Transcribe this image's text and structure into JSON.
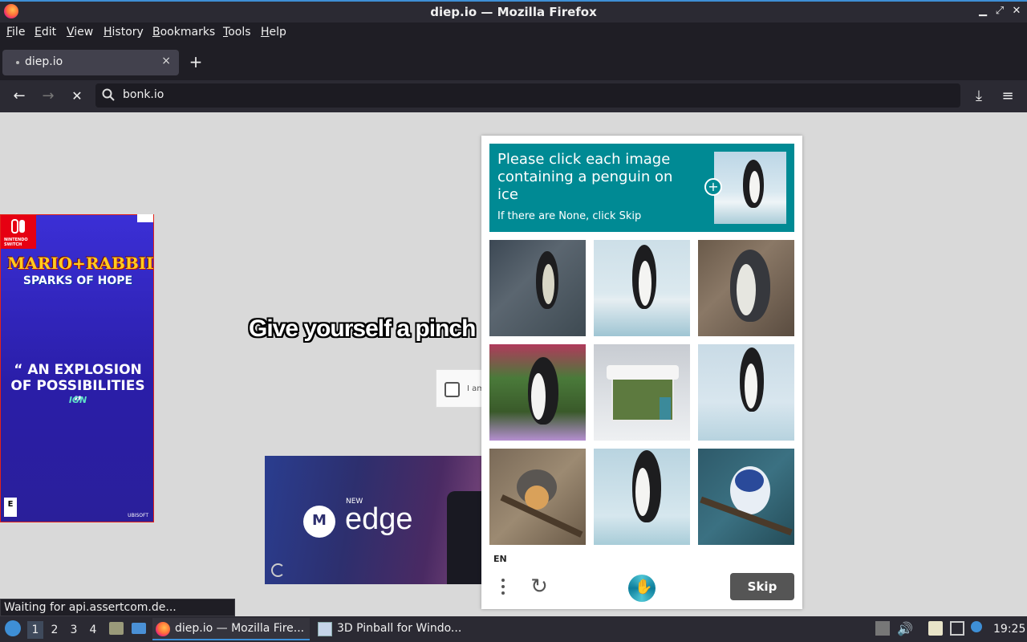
{
  "window": {
    "title": "diep.io — Mozilla Firefox"
  },
  "menubar": {
    "items": [
      {
        "label": "File",
        "u": "F",
        "rest": "ile"
      },
      {
        "label": "Edit",
        "u": "E",
        "rest": "dit"
      },
      {
        "label": "View",
        "u": "V",
        "rest": "iew"
      },
      {
        "label": "History",
        "u": "H",
        "rest": "istory"
      },
      {
        "label": "Bookmarks",
        "u": "B",
        "rest": "ookmarks"
      },
      {
        "label": "Tools",
        "u": "T",
        "rest": "ools"
      },
      {
        "label": "Help",
        "u": "H",
        "rest": "elp"
      }
    ]
  },
  "tabs": [
    {
      "label": "diep.io",
      "close": "×"
    }
  ],
  "newtab": "+",
  "nav": {
    "url": "bonk.io",
    "back": "←",
    "forward": "→",
    "stop": "✕",
    "download": "⤓",
    "menu": "≡"
  },
  "page": {
    "headline": "Give yourself a pinch",
    "checkbox_label": "I am",
    "ad_left": {
      "brand": "NINTENDO SWITCH",
      "title": "MARIO+RABBIDS",
      "subtitle": "SPARKS OF HOPE",
      "quote": "“ AN EXPLOSION OF POSSIBILITIES ”",
      "source": "IGN",
      "publisher": "UBISOFT",
      "rating": "E"
    },
    "ad_bottom": {
      "new": "NEW",
      "product": "edge"
    }
  },
  "captcha": {
    "prompt": "Please click each image containing a penguin on ice",
    "hint": "If there are None, click Skip",
    "language": "EN",
    "skip": "Skip",
    "tiles": [
      {
        "subject": "penguin on rocks"
      },
      {
        "subject": "penguin on ice"
      },
      {
        "subject": "penguin on rocks"
      },
      {
        "subject": "penguin among flowers"
      },
      {
        "subject": "snowy house"
      },
      {
        "subject": "penguin on ice"
      },
      {
        "subject": "bird on branch"
      },
      {
        "subject": "penguin on ice"
      },
      {
        "subject": "blue bird on branch"
      }
    ]
  },
  "status": "Waiting for api.assertcom.de...",
  "taskbar": {
    "workspaces": [
      "1",
      "2",
      "3",
      "4"
    ],
    "tasks": [
      "diep.io — Mozilla Fire...",
      "3D Pinball for Windo..."
    ],
    "clock": "19:25"
  },
  "colors": {
    "accent": "#3e8fd6",
    "captcha_header": "#008a94",
    "skip_button": "#555555"
  }
}
